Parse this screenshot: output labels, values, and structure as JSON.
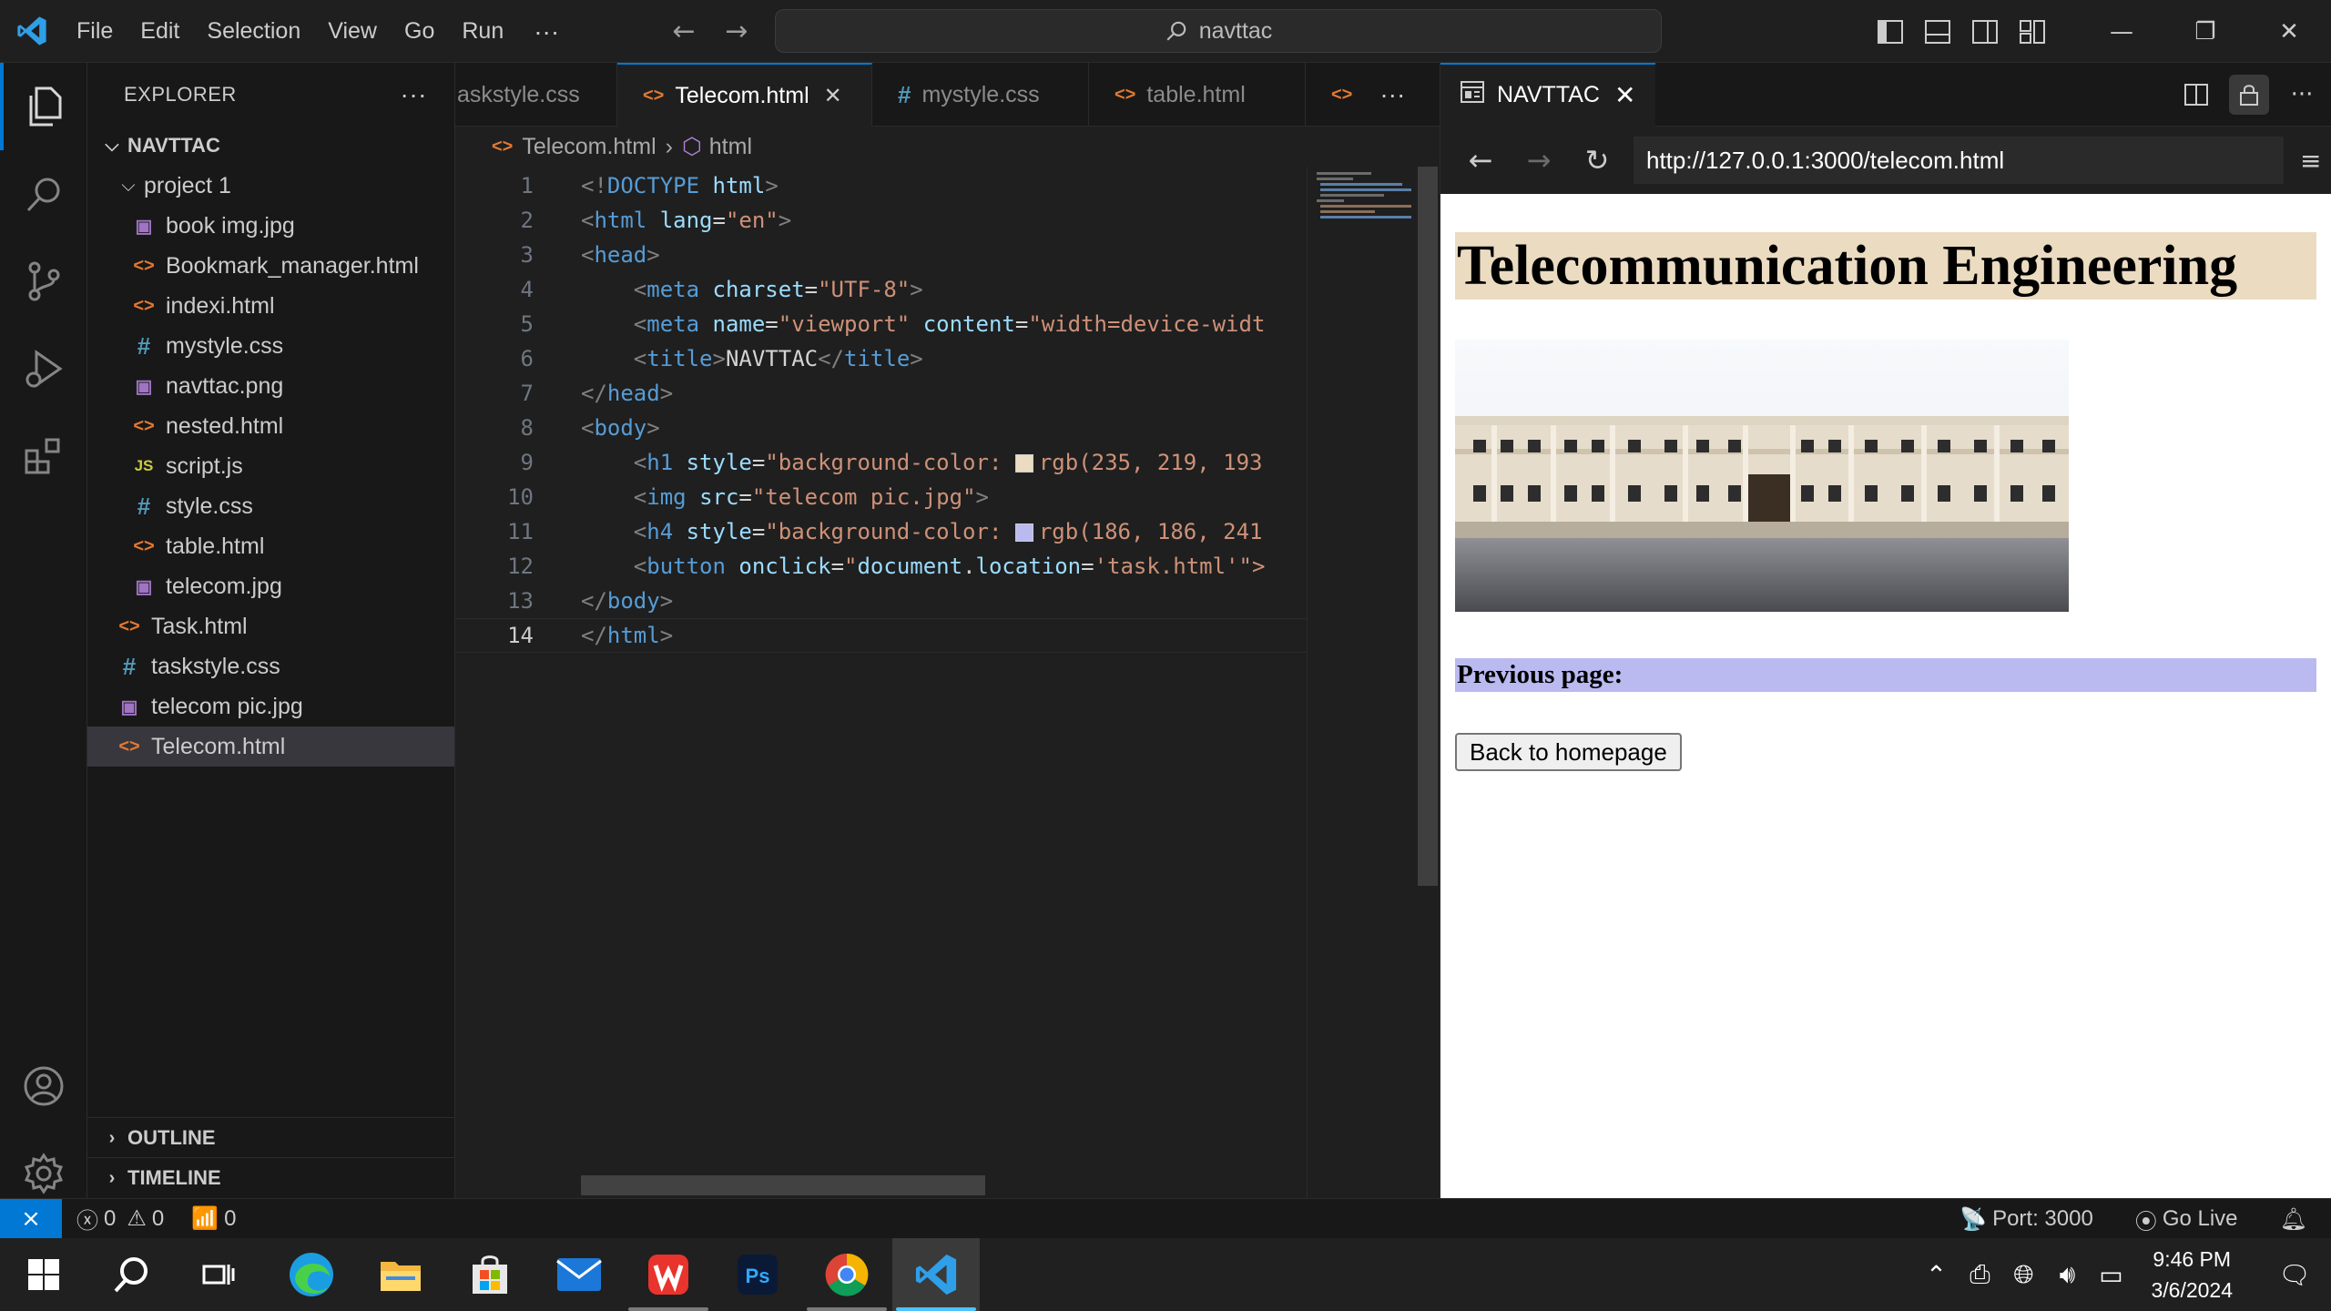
{
  "titlebar": {
    "menu": [
      "File",
      "Edit",
      "Selection",
      "View",
      "Go",
      "Run"
    ],
    "more": "···",
    "command_center": "navttac"
  },
  "sidebar": {
    "title": "EXPLORER",
    "more": "···",
    "root": "NAVTTAC",
    "folder": "project 1",
    "folder_files": [
      {
        "name": "book img.jpg",
        "type": "img"
      },
      {
        "name": "Bookmark_manager.html",
        "type": "html"
      },
      {
        "name": "indexi.html",
        "type": "html"
      },
      {
        "name": "mystyle.css",
        "type": "css"
      },
      {
        "name": "navttac.png",
        "type": "img"
      },
      {
        "name": "nested.html",
        "type": "html"
      },
      {
        "name": "script.js",
        "type": "js"
      },
      {
        "name": "style.css",
        "type": "css"
      },
      {
        "name": "table.html",
        "type": "html"
      },
      {
        "name": "telecom.jpg",
        "type": "img"
      }
    ],
    "root_files": [
      {
        "name": "Task.html",
        "type": "html"
      },
      {
        "name": "taskstyle.css",
        "type": "css"
      },
      {
        "name": "telecom pic.jpg",
        "type": "img"
      },
      {
        "name": "Telecom.html",
        "type": "html",
        "selected": true
      }
    ],
    "outline": "OUTLINE",
    "timeline": "TIMELINE"
  },
  "editor": {
    "tabs": [
      {
        "label": "askstyle.css",
        "icon": "css",
        "active": false
      },
      {
        "label": "Telecom.html",
        "icon": "html",
        "active": true
      },
      {
        "label": "mystyle.css",
        "icon": "css",
        "active": false
      },
      {
        "label": "table.html",
        "icon": "html",
        "active": false
      }
    ],
    "tabs_more": "···",
    "breadcrumb": {
      "file": "Telecom.html",
      "symbol": "html"
    },
    "current_line": 14,
    "lines": [
      {
        "n": "1",
        "tokens": [
          [
            "br",
            "<!"
          ],
          [
            "tag",
            "DOCTYPE"
          ],
          [
            "txt",
            " "
          ],
          [
            "attr",
            "html"
          ],
          [
            "br",
            ">"
          ]
        ]
      },
      {
        "n": "2",
        "tokens": [
          [
            "br",
            "<"
          ],
          [
            "tag",
            "html"
          ],
          [
            "txt",
            " "
          ],
          [
            "attr",
            "lang"
          ],
          [
            "txt",
            "="
          ],
          [
            "str",
            "\"en\""
          ],
          [
            "br",
            ">"
          ]
        ]
      },
      {
        "n": "3",
        "tokens": [
          [
            "br",
            "<"
          ],
          [
            "tag",
            "head"
          ],
          [
            "br",
            ">"
          ]
        ]
      },
      {
        "n": "4",
        "tokens": [
          [
            "txt",
            "    "
          ],
          [
            "br",
            "<"
          ],
          [
            "tag",
            "meta"
          ],
          [
            "txt",
            " "
          ],
          [
            "attr",
            "charset"
          ],
          [
            "txt",
            "="
          ],
          [
            "str",
            "\"UTF-8\""
          ],
          [
            "br",
            ">"
          ]
        ]
      },
      {
        "n": "5",
        "tokens": [
          [
            "txt",
            "    "
          ],
          [
            "br",
            "<"
          ],
          [
            "tag",
            "meta"
          ],
          [
            "txt",
            " "
          ],
          [
            "attr",
            "name"
          ],
          [
            "txt",
            "="
          ],
          [
            "str",
            "\"viewport\""
          ],
          [
            "txt",
            " "
          ],
          [
            "attr",
            "content"
          ],
          [
            "txt",
            "="
          ],
          [
            "str",
            "\"width=device-widt"
          ]
        ]
      },
      {
        "n": "6",
        "tokens": [
          [
            "txt",
            "    "
          ],
          [
            "br",
            "<"
          ],
          [
            "tag",
            "title"
          ],
          [
            "br",
            ">"
          ],
          [
            "txt",
            "NAVTTAC"
          ],
          [
            "br",
            "</"
          ],
          [
            "tag",
            "title"
          ],
          [
            "br",
            ">"
          ]
        ]
      },
      {
        "n": "7",
        "tokens": [
          [
            "br",
            "</"
          ],
          [
            "tag",
            "head"
          ],
          [
            "br",
            ">"
          ]
        ]
      },
      {
        "n": "8",
        "tokens": [
          [
            "br",
            "<"
          ],
          [
            "tag",
            "body"
          ],
          [
            "br",
            ">"
          ]
        ]
      },
      {
        "n": "9",
        "tokens": [
          [
            "txt",
            "    "
          ],
          [
            "br",
            "<"
          ],
          [
            "tag",
            "h1"
          ],
          [
            "txt",
            " "
          ],
          [
            "attr",
            "style"
          ],
          [
            "txt",
            "="
          ],
          [
            "str",
            "\"background-color: "
          ],
          [
            "swatch",
            "#ebdbc1"
          ],
          [
            "str",
            "rgb(235, 219, 193"
          ]
        ]
      },
      {
        "n": "10",
        "tokens": [
          [
            "txt",
            "    "
          ],
          [
            "br",
            "<"
          ],
          [
            "tag",
            "img"
          ],
          [
            "txt",
            " "
          ],
          [
            "attr",
            "src"
          ],
          [
            "txt",
            "="
          ],
          [
            "str",
            "\"telecom pic.jpg\""
          ],
          [
            "br",
            ">"
          ]
        ]
      },
      {
        "n": "11",
        "tokens": [
          [
            "txt",
            "    "
          ],
          [
            "br",
            "<"
          ],
          [
            "tag",
            "h4"
          ],
          [
            "txt",
            " "
          ],
          [
            "attr",
            "style"
          ],
          [
            "txt",
            "="
          ],
          [
            "str",
            "\"background-color: "
          ],
          [
            "swatch",
            "#babaf1"
          ],
          [
            "str",
            "rgb(186, 186, 241"
          ]
        ]
      },
      {
        "n": "12",
        "tokens": [
          [
            "txt",
            "    "
          ],
          [
            "br",
            "<"
          ],
          [
            "tag",
            "button"
          ],
          [
            "txt",
            " "
          ],
          [
            "attr",
            "onclick"
          ],
          [
            "txt",
            "="
          ],
          [
            "str",
            "\""
          ],
          [
            "attr",
            "document"
          ],
          [
            "txt",
            "."
          ],
          [
            "attr",
            "location"
          ],
          [
            "txt",
            "="
          ],
          [
            "str",
            "'task.html'"
          ],
          [
            "str",
            "\">"
          ]
        ]
      },
      {
        "n": "13",
        "tokens": [
          [
            "br",
            "</"
          ],
          [
            "tag",
            "body"
          ],
          [
            "br",
            ">"
          ]
        ]
      },
      {
        "n": "14",
        "tokens": [
          [
            "br",
            "</"
          ],
          [
            "tag",
            "html"
          ],
          [
            "br",
            ">"
          ]
        ]
      }
    ]
  },
  "preview": {
    "tab_label": "NAVTTAC",
    "url": "http://127.0.0.1:3000/telecom.html",
    "page": {
      "h1": "Telecommunication Engineering",
      "h4": "Previous page:",
      "button": "Back to homepage"
    }
  },
  "statusbar": {
    "errors": "0",
    "warnings": "0",
    "ports": "0",
    "port": "Port: 3000",
    "golive": "Go Live"
  },
  "taskbar": {
    "time": "9:46 PM",
    "date": "3/6/2024"
  },
  "colors": {
    "accent": "#0078d4",
    "h1_bg": "#ebdbc1",
    "h4_bg": "#babaf1"
  }
}
